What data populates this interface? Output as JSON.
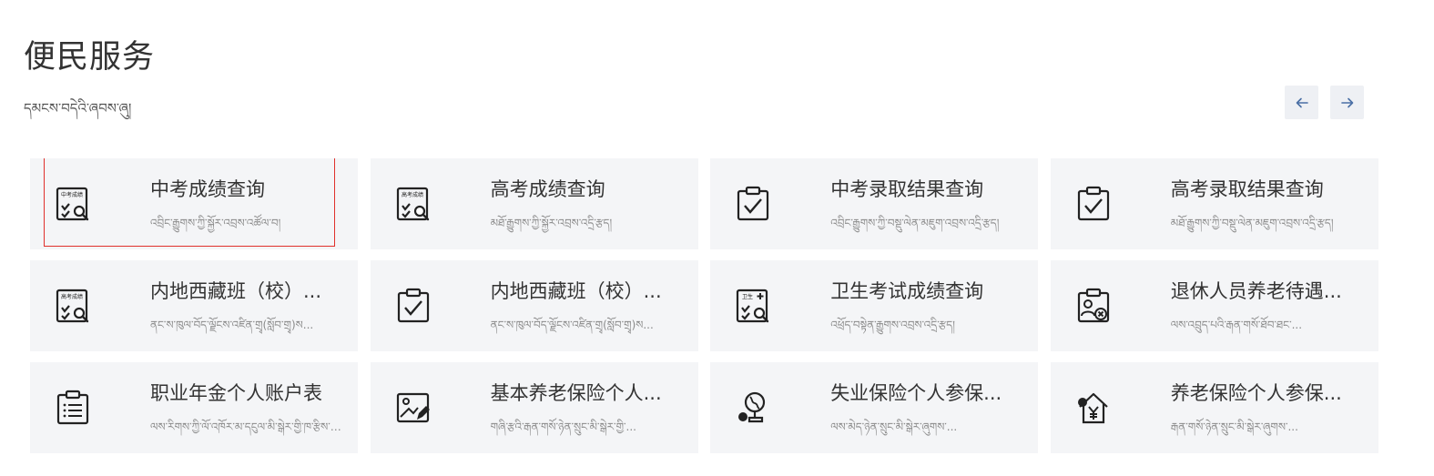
{
  "header": {
    "title": "便民服务",
    "subtitle": "དམངས་བདེའི་ཞབས་ཞུ།",
    "prev_icon": "arrow-left-icon",
    "next_icon": "arrow-right-icon"
  },
  "icon_labels": {
    "zhongkao": "中考成绩",
    "gaokao": "高考成绩",
    "weisheng": "卫生"
  },
  "services": [
    {
      "title": "中考成绩查询",
      "subtitle": "འབྲིང་རྒྱུགས་ཀྱི་སྐྱོར་འབྲས་འཚོལ་བ།",
      "icon": "exam-score-search-icon"
    },
    {
      "title": "高考成绩查询",
      "subtitle": "མཐོ་རྒྱུགས་ཀྱི་སྐྱོར་འབྲས་འདྲི་རྩད།",
      "icon": "exam-score-search-icon"
    },
    {
      "title": "中考录取结果查询",
      "subtitle": "འབྲིང་རྒྱུགས་ཀྱི་བསྡུ་ལེན་མཇུག་འབྲས་འདྲི་རྩད།",
      "icon": "clipboard-check-icon"
    },
    {
      "title": "高考录取结果查询",
      "subtitle": "མཐོ་རྒྱུགས་ཀྱི་བསྡུ་ལེན་མཇུག་འབྲས་འདྲི་རྩད།",
      "icon": "clipboard-check-icon"
    },
    {
      "title": "内地西藏班（校）...",
      "subtitle": "ནང་ས་ཁུལ་བོད་ལྗོངས་འཛིན་གྲྭ(སློབ་གྲྭ)ས...",
      "icon": "exam-score-search-icon"
    },
    {
      "title": "内地西藏班（校）...",
      "subtitle": "ནང་ས་ཁུལ་བོད་ལྗོངས་འཛིན་གྲྭ(སློབ་གྲྭ)ས...",
      "icon": "clipboard-check-icon"
    },
    {
      "title": "卫生考试成绩查询",
      "subtitle": "འཕྲོད་བསྟེན་རྒྱུགས་འབྲས་འདྲི་རྩད།",
      "icon": "health-score-search-icon"
    },
    {
      "title": "退休人员养老待遇...",
      "subtitle": "ལས་འབྲུད་པའི་རྒན་གསོ་ཐོབ་ཐང་...",
      "icon": "retiree-card-icon"
    },
    {
      "title": "职业年金个人账户表",
      "subtitle": "ལས་རིགས་ཀྱི་ལོ་འཁོར་མ་དངུལ་མི་སྒེར་གྱི་ཁ་རྩིས་རེའུ...",
      "icon": "list-clipboard-icon"
    },
    {
      "title": "基本养老保险个人...",
      "subtitle": "གཞི་རྩའི་རྒན་གསོ་ཉེན་སྲུང་མི་སྒེར་གྱི་...",
      "icon": "image-edit-icon"
    },
    {
      "title": "失业保险个人参保...",
      "subtitle": "ལས་མེད་ཉེན་སྲུང་མི་སྒེར་ཞུགས་...",
      "icon": "globe-person-icon"
    },
    {
      "title": "养老保险个人参保...",
      "subtitle": "རྒན་གསོ་ཉེན་སྲུང་མི་སྒེར་ཞུགས་...",
      "icon": "house-yuan-icon"
    }
  ]
}
